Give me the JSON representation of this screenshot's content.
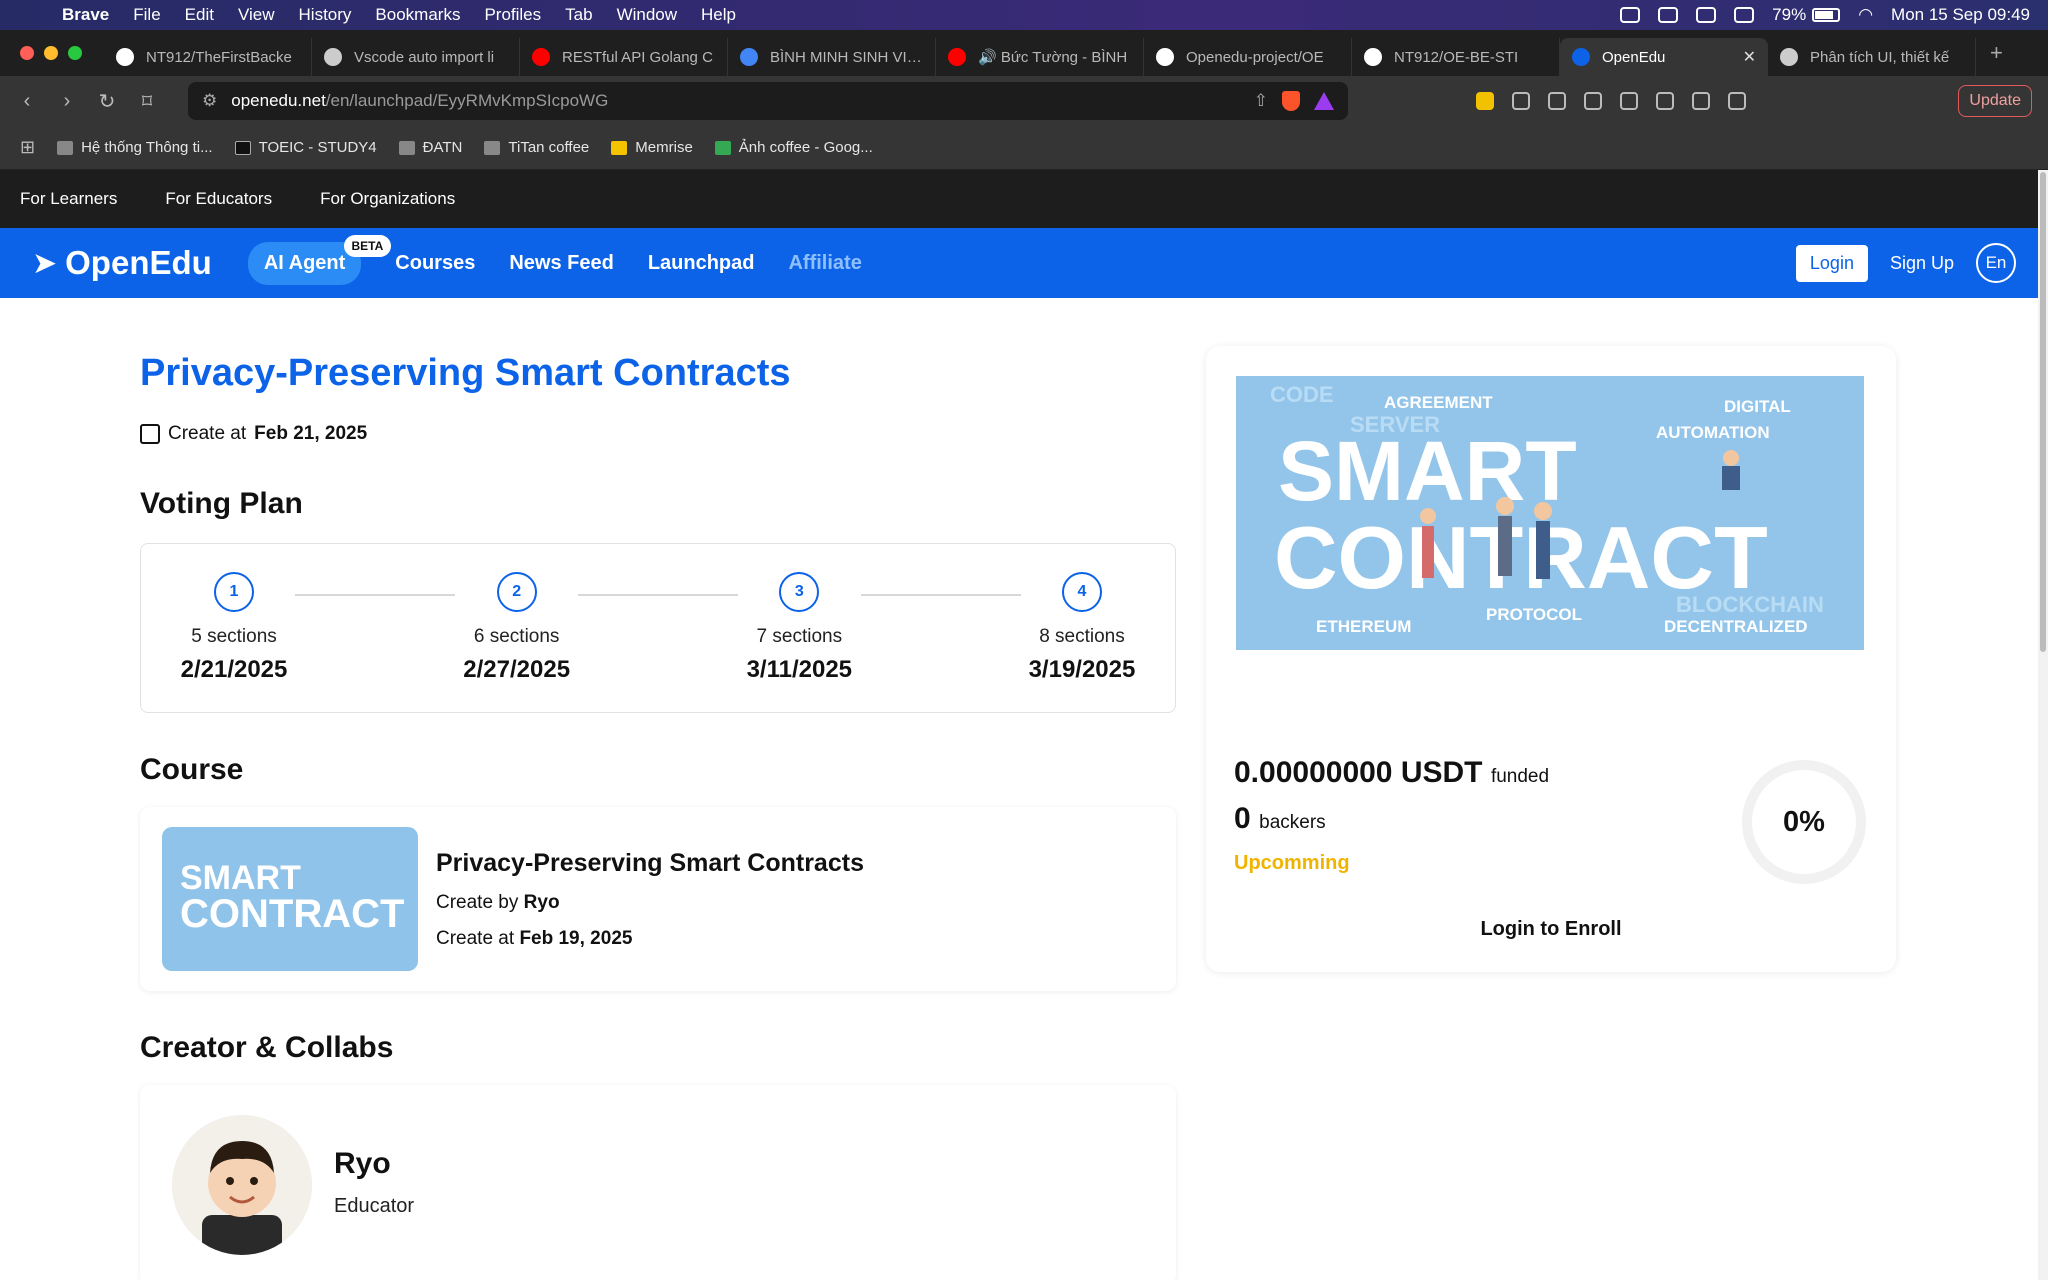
{
  "menubar": {
    "app": "Brave",
    "items": [
      "File",
      "Edit",
      "View",
      "History",
      "Bookmarks",
      "Profiles",
      "Tab",
      "Window",
      "Help"
    ],
    "battery": "79%",
    "battery_level": 0.79,
    "datetime": "Mon 15 Sep  09:49"
  },
  "tabs": [
    {
      "label": "NT912/TheFirstBacke",
      "icon_color": "#ffffff"
    },
    {
      "label": "Vscode auto import li",
      "icon_color": "#cccccc"
    },
    {
      "label": "RESTful API Golang C",
      "icon_color": "#ff0000"
    },
    {
      "label": "BÌNH MINH SINH VIÊ...",
      "icon_color": "#4285f4"
    },
    {
      "label": "🔊 Bức Tường - BÌNH",
      "icon_color": "#ff0000"
    },
    {
      "label": "Openedu-project/OE",
      "icon_color": "#ffffff"
    },
    {
      "label": "NT912/OE-BE-STI",
      "icon_color": "#ffffff"
    },
    {
      "label": "OpenEdu",
      "icon_color": "#0c63e8",
      "active": true
    },
    {
      "label": "Phân tích UI, thiết kế",
      "icon_color": "#cccccc"
    }
  ],
  "url": {
    "host": "openedu.net",
    "path": "/en/launchpad/EyyRMvKmpSIcpoWG"
  },
  "toolbar": {
    "update_label": "Update"
  },
  "bookmarks": [
    "Hệ thống Thông ti...",
    "TOEIC - STUDY4",
    "ĐATN",
    "TiTan coffee",
    "Memrise",
    "Ảnh coffee - Goog..."
  ],
  "topnav": [
    "For Learners",
    "For Educators",
    "For Organizations"
  ],
  "header": {
    "logo": "OpenEdu",
    "ai_agent": "AI Agent",
    "beta": "BETA",
    "links": [
      "Courses",
      "News Feed",
      "Launchpad"
    ],
    "affiliate": "Affiliate",
    "login": "Login",
    "signup": "Sign Up",
    "lang": "En"
  },
  "project": {
    "title": "Privacy-Preserving Smart Contracts",
    "create_label": "Create at",
    "create_date": "Feb 21, 2025"
  },
  "voting": {
    "title": "Voting Plan",
    "steps": [
      {
        "num": "1",
        "sections": "5 sections",
        "date": "2/21/2025"
      },
      {
        "num": "2",
        "sections": "6 sections",
        "date": "2/27/2025"
      },
      {
        "num": "3",
        "sections": "7 sections",
        "date": "3/11/2025"
      },
      {
        "num": "4",
        "sections": "8 sections",
        "date": "3/19/2025"
      }
    ]
  },
  "course": {
    "heading": "Course",
    "name": "Privacy-Preserving Smart Contracts",
    "create_by_label": "Create by",
    "author": "Ryo",
    "create_at_label": "Create at",
    "date": "Feb 19, 2025"
  },
  "creator": {
    "heading": "Creator & Collabs",
    "name": "Ryo",
    "role": "Educator"
  },
  "funding": {
    "amount": "0.00000000 USDT",
    "funded_label": "funded",
    "backers": "0",
    "backers_label": "backers",
    "status": "Upcomming",
    "percent": "0%",
    "enroll": "Login to Enroll"
  },
  "banner": {
    "line1": "SMART",
    "line2": "CONTRACT",
    "words": [
      "AGREEMENT",
      "DIGITAL",
      "AUTOMATION",
      "CODE",
      "SERVER",
      "ETHEREUM",
      "PROTOCOL",
      "DECENTRALIZED",
      "BLOCKCHAIN"
    ]
  }
}
